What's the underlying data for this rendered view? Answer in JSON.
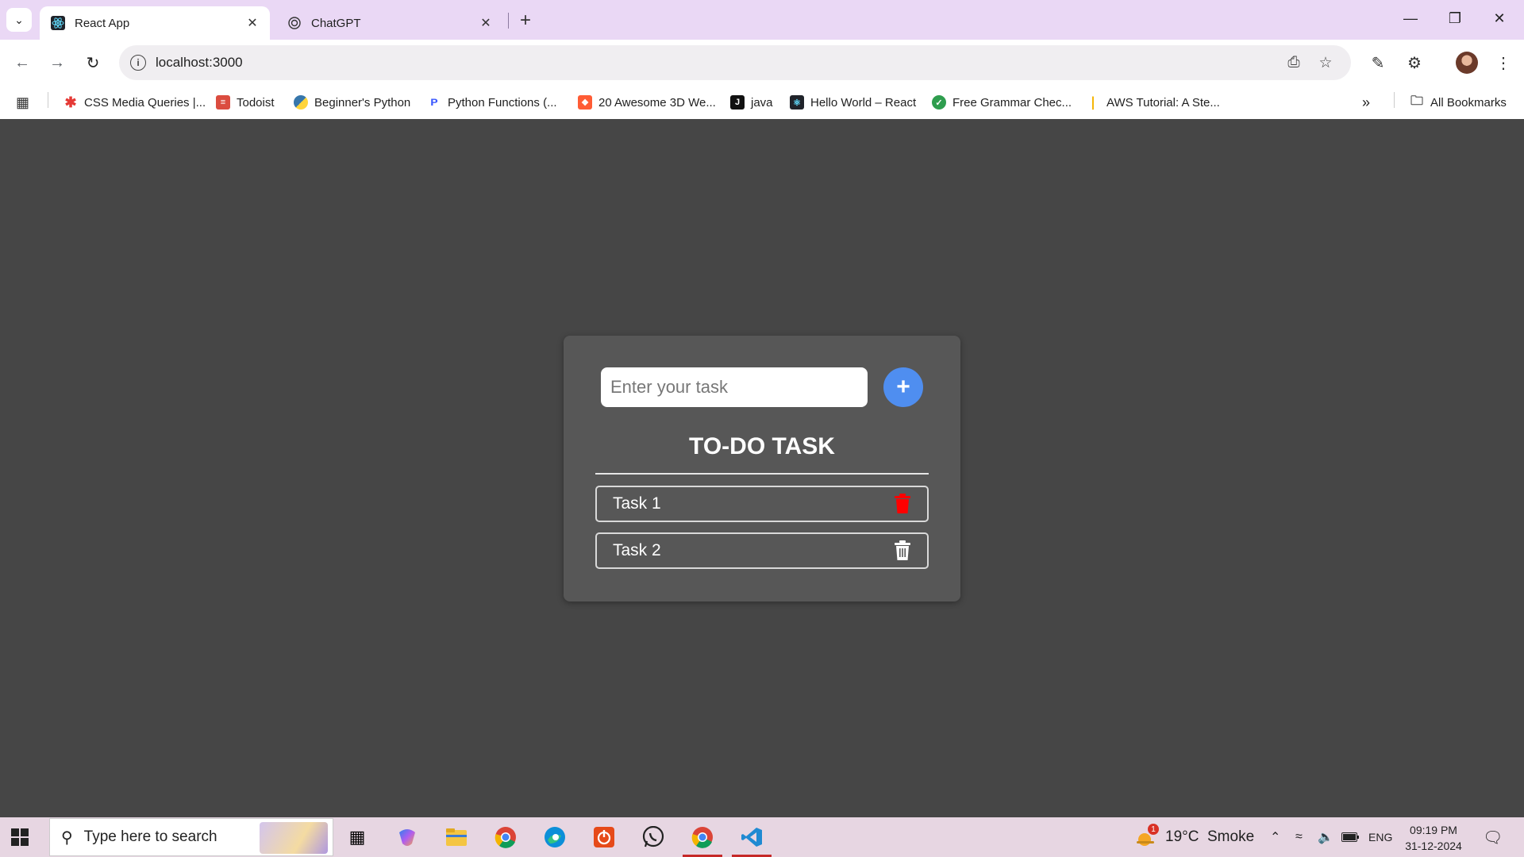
{
  "browser": {
    "tabs": [
      {
        "title": "React App",
        "favicon": "react-logo-icon",
        "active": true
      },
      {
        "title": "ChatGPT",
        "favicon": "openai-logo-icon",
        "active": false
      }
    ],
    "address": "localhost:3000",
    "bookmarks": [
      {
        "label": "CSS Media Queries |...",
        "icon": "asterisk-red-icon",
        "color": "#e53935"
      },
      {
        "label": "Todoist",
        "icon": "todoist-icon",
        "color": "#db4c3f"
      },
      {
        "label": "Beginner's Python",
        "icon": "python-icon",
        "color": "#3776ab"
      },
      {
        "label": "Python Functions (...",
        "icon": "p-logo-icon",
        "color": "#3d5afe"
      },
      {
        "label": "20 Awesome 3D We...",
        "icon": "hubspot-icon",
        "color": "#ff5c35"
      },
      {
        "label": "java",
        "icon": "j-logo-icon",
        "color": "#111111"
      },
      {
        "label": "Hello World – React",
        "icon": "react-logo-icon",
        "color": "#20232a"
      },
      {
        "label": "Free Grammar Chec...",
        "icon": "grammar-icon",
        "color": "#2e9d4e"
      },
      {
        "label": "AWS Tutorial: A Ste...",
        "icon": "aws-tutorial-icon",
        "color": "#f5b400"
      }
    ],
    "all_bookmarks": "All Bookmarks"
  },
  "app": {
    "input_placeholder": "Enter your task",
    "add_symbol": "+",
    "heading": "TO-DO TASK",
    "tasks": [
      {
        "label": "Task 1",
        "trash_color": "#ff0000"
      },
      {
        "label": "Task 2",
        "trash_color": "#ffffff"
      }
    ]
  },
  "taskbar": {
    "search_placeholder": "Type here to search",
    "weather": "19°C  Smoke",
    "weather_badge": "1",
    "language": "ENG",
    "time": "09:19 PM",
    "date": "31-12-2024"
  }
}
